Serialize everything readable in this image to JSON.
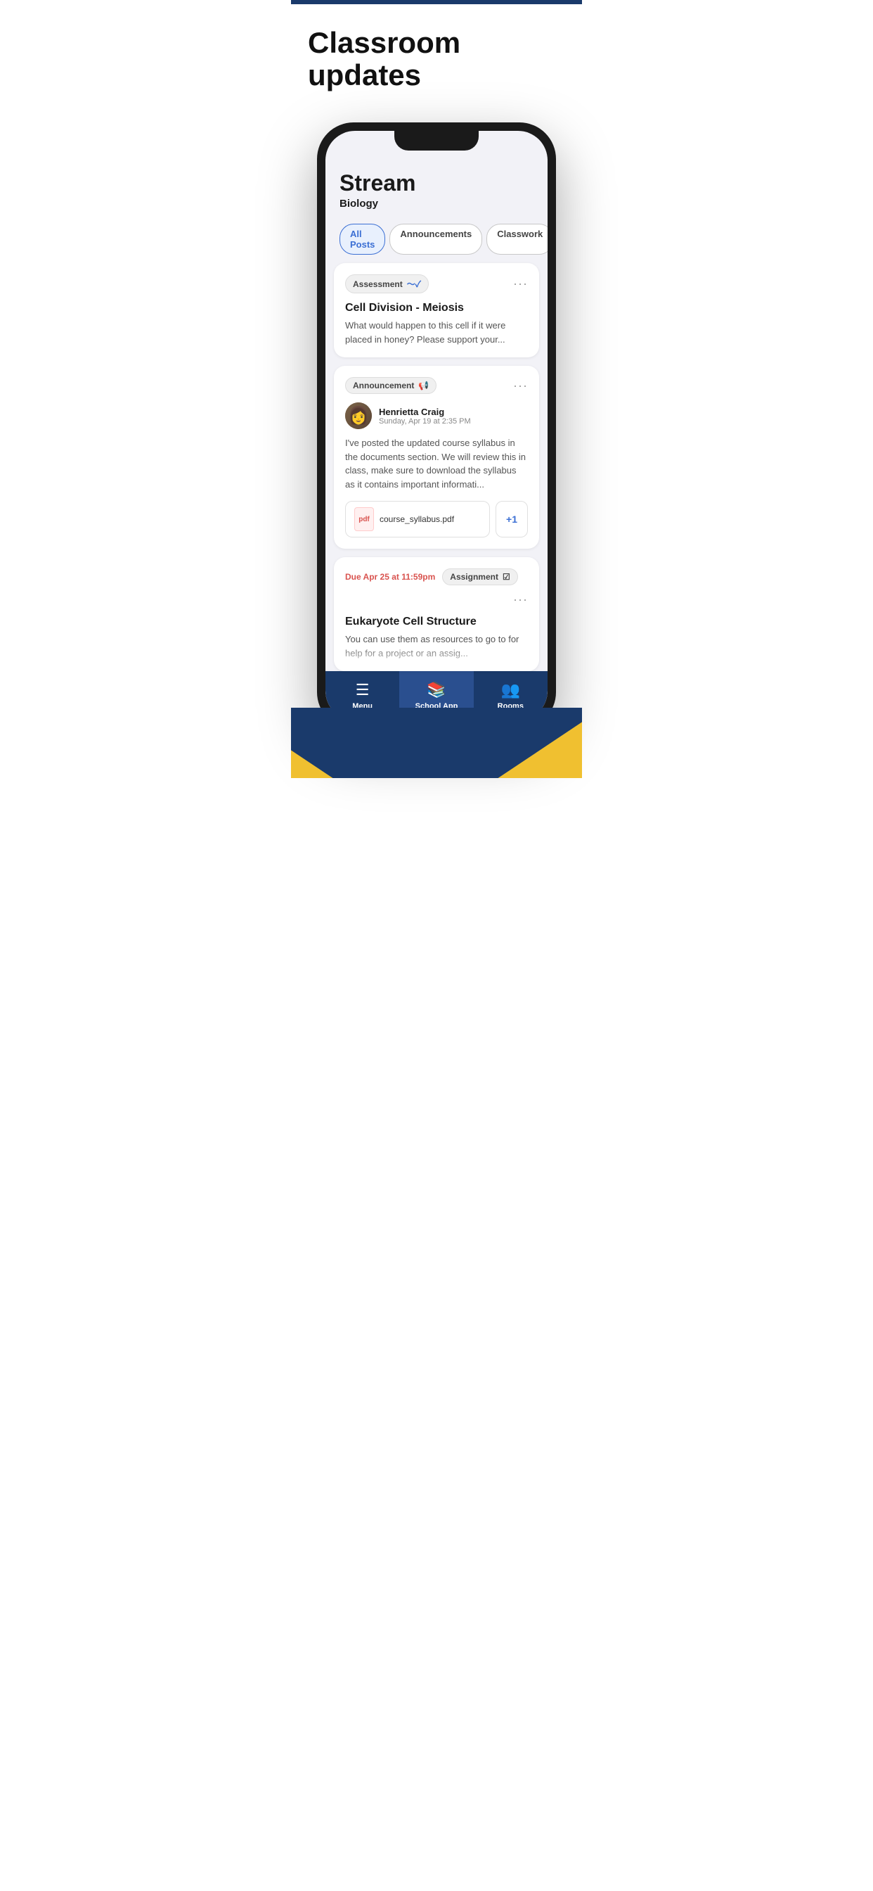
{
  "page": {
    "top_bar_color": "#1a3a6b",
    "header": {
      "title": "Classroom updates"
    }
  },
  "phone": {
    "screen": {
      "stream_title": "Stream",
      "stream_subtitle": "Biology",
      "tabs": [
        {
          "label": "All Posts",
          "active": true
        },
        {
          "label": "Announcements",
          "active": false
        },
        {
          "label": "Classwork",
          "active": false
        }
      ],
      "cards": [
        {
          "badge_label": "Assessment",
          "title": "Cell Division - Meiosis",
          "body": "What would happen to this cell if it were placed in honey? Please support your..."
        },
        {
          "badge_label": "Announcement",
          "user_name": "Henrietta Craig",
          "user_date": "Sunday, Apr 19 at 2:35 PM",
          "body": "I've posted the updated course syllabus in the documents section. We will review this in class, make sure to download the syllabus as it contains important informati...",
          "attachment_name": "course_syllabus.pdf",
          "attachment_more": "+1"
        },
        {
          "due_label": "Due Apr 25 at 11:59pm",
          "badge_label": "Assignment",
          "title": "Eukaryote Cell Structure",
          "body": "You can use them as resources to go to for help for a project or an assig..."
        }
      ],
      "nav": [
        {
          "label": "Menu",
          "icon": "☰",
          "active": false
        },
        {
          "label": "School App",
          "icon": "📚",
          "active": true
        },
        {
          "label": "Rooms",
          "icon": "👥",
          "active": false
        }
      ]
    }
  }
}
